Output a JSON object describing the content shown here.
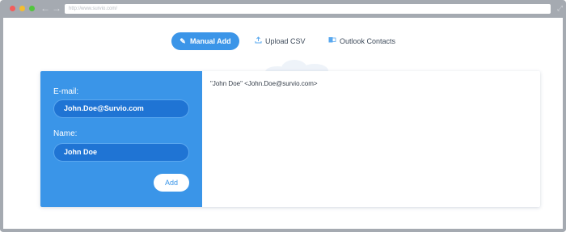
{
  "browser": {
    "url": "http://www.survio.com/"
  },
  "tabs": [
    {
      "label": "Manual Add",
      "icon": "pencil-icon",
      "active": true
    },
    {
      "label": "Upload CSV",
      "icon": "upload-icon",
      "active": false
    },
    {
      "label": "Outlook Contacts",
      "icon": "outlook-icon",
      "active": false
    }
  ],
  "form": {
    "email_label": "E-mail:",
    "email_value": "John.Doe@Survio.com",
    "name_label": "Name:",
    "name_value": "John Doe",
    "add_label": "Add"
  },
  "contacts": {
    "entries": [
      "\"John Doe\" <John.Doe@survio.com>"
    ]
  },
  "colors": {
    "accent": "#3a95e8",
    "frame": "#a5aab1"
  }
}
